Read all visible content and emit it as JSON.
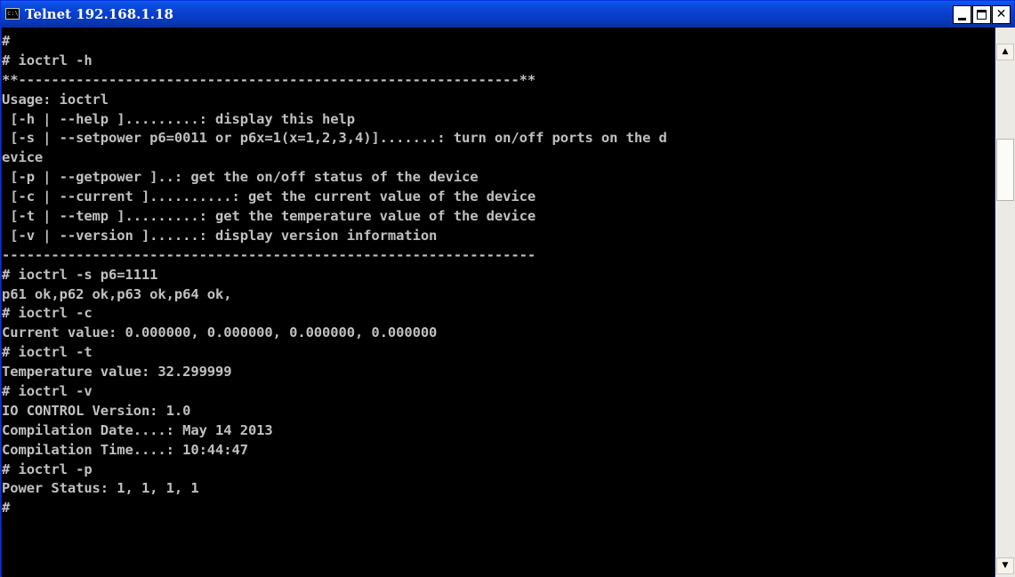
{
  "window": {
    "title": "Telnet 192.168.1.18",
    "icon_label": "c:\\",
    "controls": {
      "minimize": "minimize-icon",
      "maximize": "maximize-icon",
      "close": "✕"
    }
  },
  "console": {
    "lines": [
      "#",
      "# ioctrl -h",
      "**-------------------------------------------------------------**",
      "Usage: ioctrl",
      " [-h | --help ].........: display this help",
      " [-s | --setpower p6=0011 or p6x=1(x=1,2,3,4)].......: turn on/off ports on the d",
      "evice",
      " [-p | --getpower ]..: get the on/off status of the device",
      " [-c | --current ]..........: get the current value of the device",
      " [-t | --temp ].........: get the temperature value of the device",
      " [-v | --version ]......: display version information",
      "-----------------------------------------------------------------",
      "# ioctrl -s p6=1111",
      "p61 ok,p62 ok,p63 ok,p64 ok,",
      "# ioctrl -c",
      "Current value: 0.000000, 0.000000, 0.000000, 0.000000",
      "# ioctrl -t",
      "Temperature value: 32.299999",
      "# ioctrl -v",
      "IO CONTROL Version: 1.0",
      "Compilation Date....: May 14 2013",
      "Compilation Time....: 10:44:47",
      "# ioctrl -p",
      "Power Status: 1, 1, 1, 1",
      "#"
    ]
  },
  "scrollbar": {
    "up_arrow": "▲",
    "down_arrow": "▼"
  },
  "colors": {
    "title_bar": "#0a3fcf",
    "console_bg": "#000000",
    "console_text": "#c0c0c0"
  }
}
